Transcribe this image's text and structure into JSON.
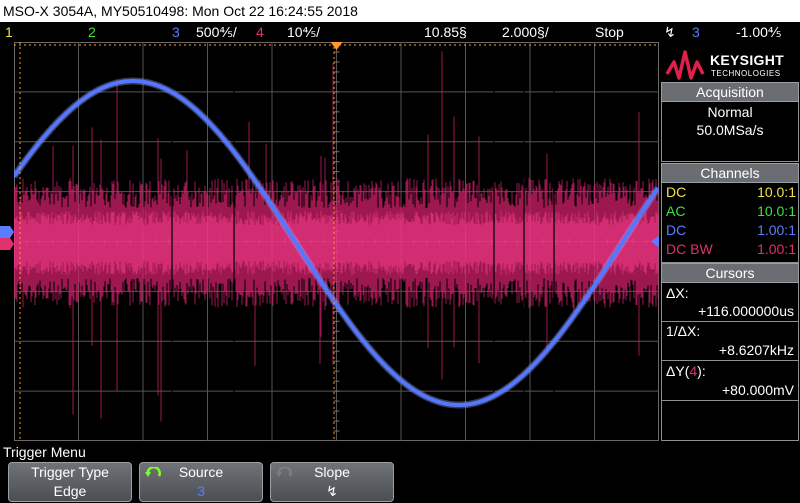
{
  "title_bar": "MSO-X 3054A, MY50510498: Mon Oct 22 16:24:55 2018",
  "status_bar": {
    "ch1_label": "1",
    "ch2_label": "2",
    "ch3_label": "3",
    "ch3_scale": "500⅘/",
    "ch4_label": "4",
    "ch4_scale": "10⅘/",
    "delay": "10.85§",
    "timebase": "2.000§/",
    "run_state": "Stop",
    "trigger_symbol": "↯",
    "trigger_source": "3",
    "trigger_level": "-1.00⅘",
    "colors": {
      "ch1": "#f2e24a",
      "ch2": "#3fe03f",
      "ch3": "#5a7cff",
      "ch4": "#e0306f"
    }
  },
  "logo": {
    "brand": "KEYSIGHT",
    "sub": "TECHNOLOGIES"
  },
  "acquisition": {
    "title": "Acquisition",
    "mode": "Normal",
    "rate": "50.0MSa/s"
  },
  "channels": {
    "title": "Channels",
    "rows": [
      {
        "coupling": "DC",
        "ratio": "10.0:1",
        "color": "#f2e24a"
      },
      {
        "coupling": "AC",
        "ratio": "10.0:1",
        "color": "#3fe03f"
      },
      {
        "coupling": "DC",
        "ratio": "1.00:1",
        "color": "#5a7cff"
      },
      {
        "coupling": "DC BW",
        "ratio": "1.00:1",
        "color": "#e0306f"
      }
    ]
  },
  "cursors": {
    "title": "Cursors",
    "dx_label": "ΔX:",
    "dx_value": "+116.000000us",
    "inv_dx_label": "1/ΔX:",
    "inv_dx_value": "+8.6207kHz",
    "dy_label_prefix": "ΔY(",
    "dy_channel": "4",
    "dy_label_suffix": "):",
    "dy_value": "+80.000mV"
  },
  "trigger_menu": {
    "title": "Trigger Menu",
    "softkeys": [
      {
        "label": "Trigger Type",
        "value": "Edge"
      },
      {
        "label": "Source",
        "value": "3"
      },
      {
        "label": "Slope",
        "value": "↯"
      }
    ]
  },
  "waveforms": {
    "ch3_color": "#5577ff",
    "ch4_color": "#d0206a"
  }
}
